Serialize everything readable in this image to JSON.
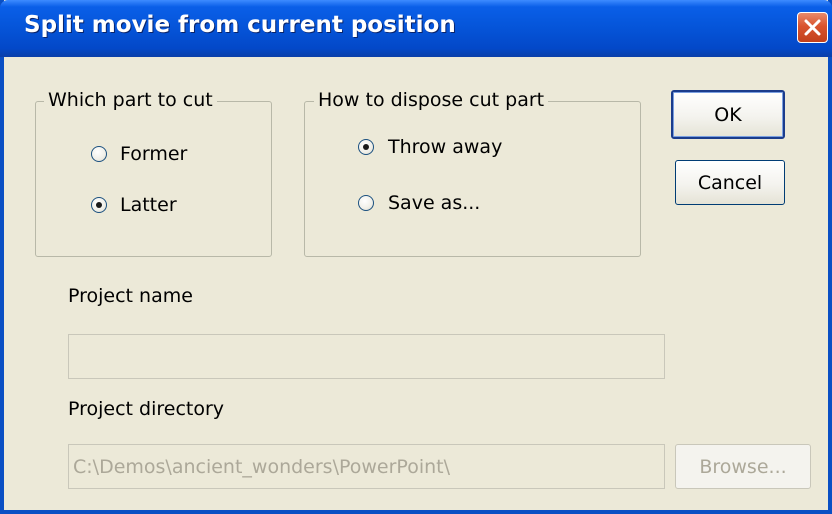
{
  "window": {
    "title": "Split movie from current position"
  },
  "which_part": {
    "label": "Which part to cut",
    "options": [
      {
        "label": "Former",
        "selected": false
      },
      {
        "label": "Latter",
        "selected": true
      }
    ]
  },
  "dispose": {
    "label": "How to dispose cut part",
    "options": [
      {
        "label": "Throw away",
        "selected": true
      },
      {
        "label": "Save as...",
        "selected": false
      }
    ]
  },
  "buttons": {
    "ok": "OK",
    "cancel": "Cancel",
    "browse": "Browse..."
  },
  "project_name": {
    "label": "Project name",
    "value": ""
  },
  "project_directory": {
    "label": "Project directory",
    "value": "C:\\Demos\\ancient_wonders\\PowerPoint\\"
  },
  "colors": {
    "titlebar": "#0554d8",
    "dialog_bg": "#ece9d8",
    "close_button": "#d9542f"
  }
}
